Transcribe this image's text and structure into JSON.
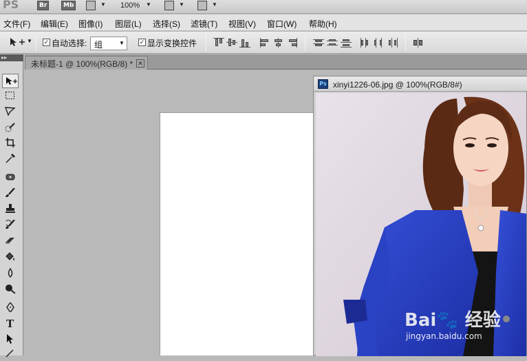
{
  "appbar": {
    "logo": "PS",
    "bridge_badge": "Br",
    "mini_bridge_badge": "Mb",
    "zoom": "100%"
  },
  "menu": {
    "items": [
      "文件(F)",
      "编辑(E)",
      "图像(I)",
      "图层(L)",
      "选择(S)",
      "滤镜(T)",
      "视图(V)",
      "窗口(W)",
      "帮助(H)"
    ]
  },
  "options": {
    "auto_select_label": "自动选择:",
    "auto_select_checked": true,
    "auto_select_value": "组",
    "show_transform_label": "显示变换控件",
    "show_transform_checked": true
  },
  "tabs": {
    "active_doc": "未标题-1 @ 100%(RGB/8) *",
    "close_glyph": "✕"
  },
  "image_window": {
    "title": "xinyi1226-06.jpg @ 100%(RGB/8#)",
    "badge": "Ps"
  },
  "watermark": {
    "main": "Bai🐾 经验",
    "sub": "jingyan.baidu.com"
  },
  "colors": {
    "accent_blue": "#2a43c9",
    "workspace_gray": "#b9b9b9"
  }
}
